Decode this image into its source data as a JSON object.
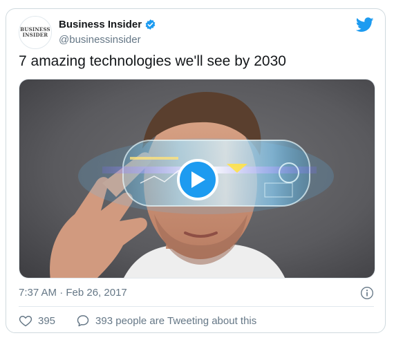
{
  "author": {
    "avatar_text_line1": "BUSINESS",
    "avatar_text_line2": "INSIDER",
    "name": "Business Insider",
    "handle": "@businessinsider",
    "verified": true
  },
  "tweet": {
    "text": "7 amazing technologies we'll see by 2030",
    "time": "7:37 AM · Feb 26, 2017"
  },
  "actions": {
    "likes": "395",
    "conversation": "393 people are Tweeting about this"
  },
  "icons": {
    "brand": "twitter-bird-icon",
    "verified": "verified-badge-icon",
    "play": "play-icon",
    "info": "info-icon",
    "like": "heart-icon",
    "reply": "speech-bubble-icon"
  },
  "colors": {
    "accent": "#1d9bf0",
    "text": "#14171a",
    "muted": "#657786",
    "border": "#cfd9de"
  }
}
